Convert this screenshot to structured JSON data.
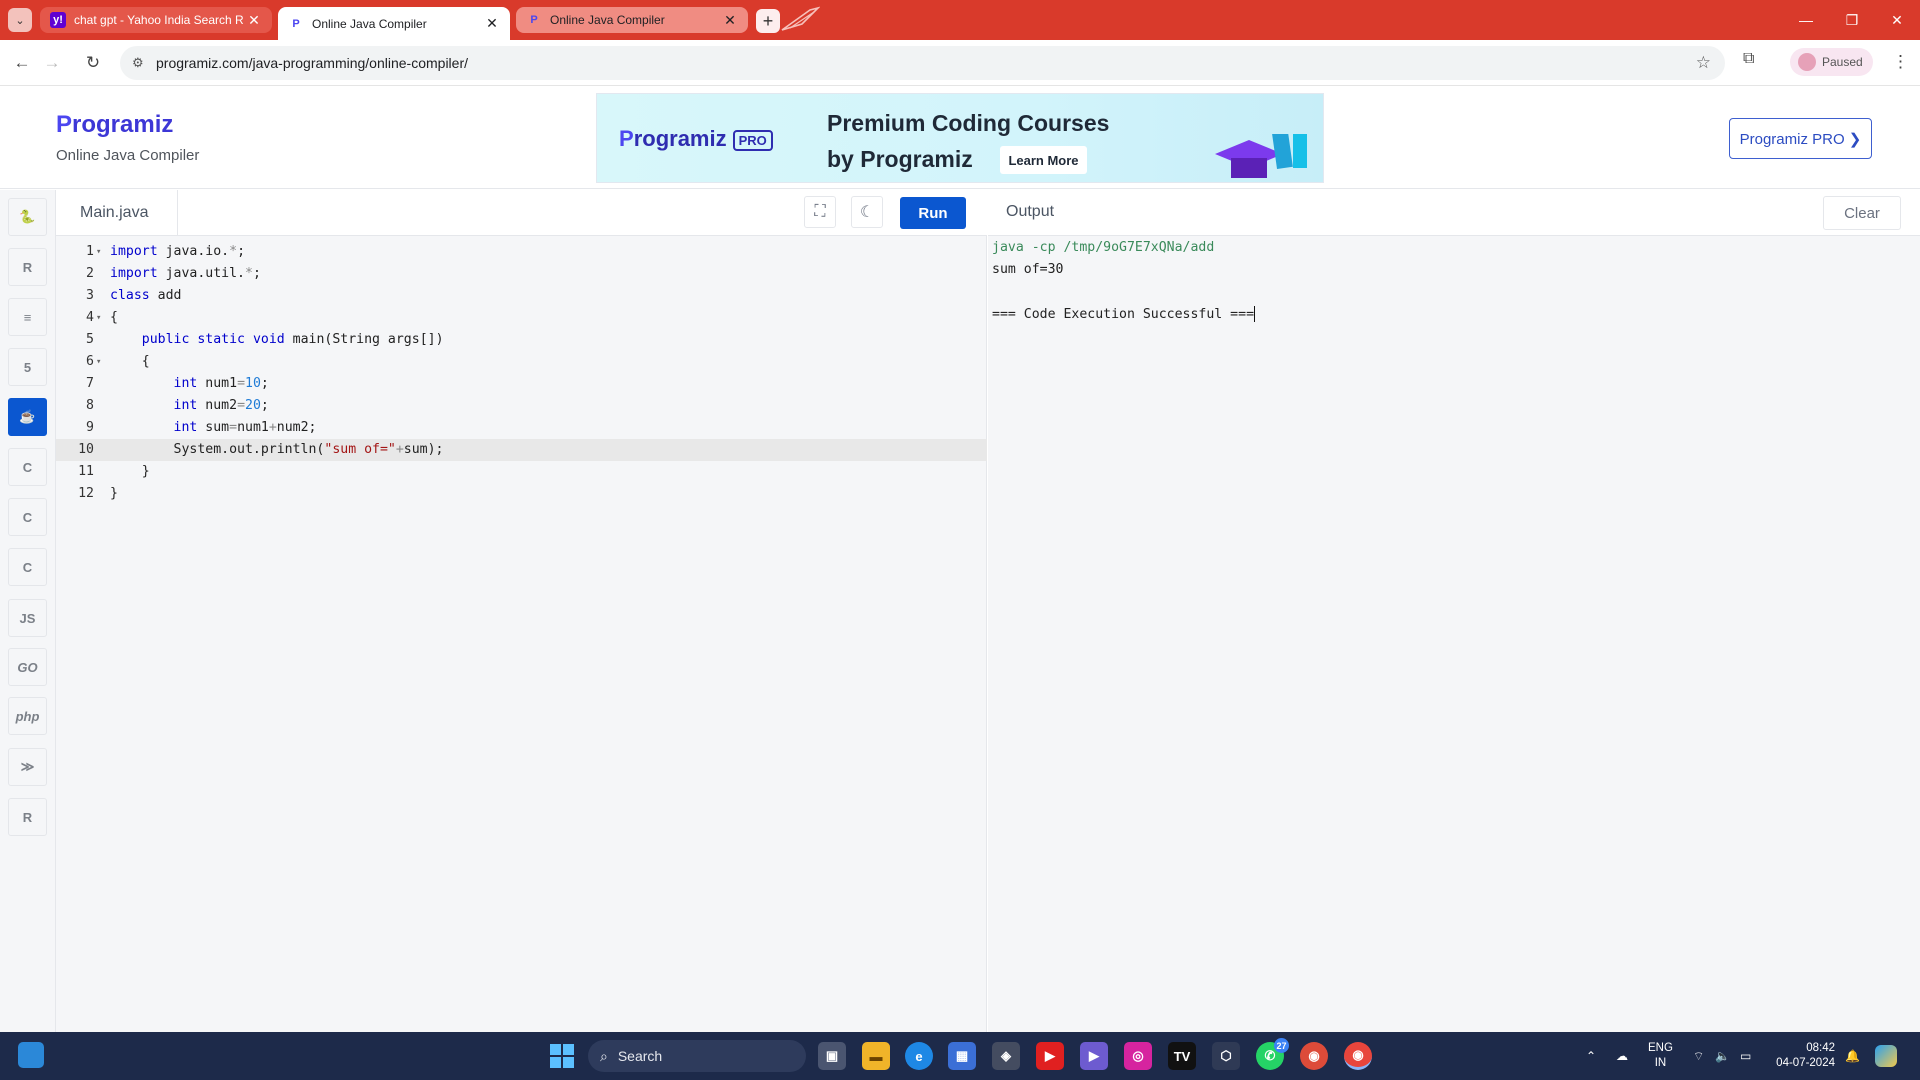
{
  "browser": {
    "tabs": [
      {
        "title": "chat gpt - Yahoo India Search R",
        "favicon": "yahoo-icon"
      },
      {
        "title": "Online Java Compiler",
        "favicon": "programiz-icon"
      },
      {
        "title": "Online Java Compiler",
        "favicon": "programiz-icon"
      }
    ],
    "url": "programiz.com/java-programming/online-compiler/",
    "profile_label": "Paused"
  },
  "site": {
    "logo_text": "rogramiz",
    "logo_letter": "P",
    "subtitle": "Online Java Compiler",
    "banner": {
      "logo_text": "rogramiz",
      "logo_letter": "P",
      "pro_tag": "PRO",
      "line1": "Premium Coding Courses",
      "line2": "by Programiz",
      "cta": "Learn More"
    },
    "pro_button": "Programiz PRO ❯"
  },
  "sidebar": {
    "languages": [
      {
        "name": "python",
        "glyph": "🐍",
        "active": false
      },
      {
        "name": "r",
        "glyph": "R",
        "active": false
      },
      {
        "name": "sql",
        "glyph": "≡",
        "active": false
      },
      {
        "name": "html",
        "glyph": "5",
        "active": false
      },
      {
        "name": "java",
        "glyph": "☕",
        "active": true
      },
      {
        "name": "c",
        "glyph": "C",
        "active": false
      },
      {
        "name": "cpp",
        "glyph": "C",
        "active": false
      },
      {
        "name": "csharp",
        "glyph": "C",
        "active": false
      },
      {
        "name": "javascript",
        "glyph": "JS",
        "active": false
      },
      {
        "name": "go",
        "glyph": "GO",
        "active": false
      },
      {
        "name": "php",
        "glyph": "php",
        "active": false
      },
      {
        "name": "swift",
        "glyph": "≫",
        "active": false
      },
      {
        "name": "rust",
        "glyph": "R",
        "active": false
      }
    ]
  },
  "editor": {
    "file_name": "Main.java",
    "run_label": "Run",
    "highlighted_line": 10,
    "lines": [
      {
        "n": "1",
        "fold": true,
        "html": "<span class='kw'>import</span> java.io.<span class='op'>*</span>;"
      },
      {
        "n": "2",
        "fold": false,
        "html": "<span class='kw'>import</span> java.util.<span class='op'>*</span>;"
      },
      {
        "n": "3",
        "fold": false,
        "html": "<span class='kw'>class</span> add"
      },
      {
        "n": "4",
        "fold": true,
        "html": "{"
      },
      {
        "n": "5",
        "fold": false,
        "html": "    <span class='kw'>public</span> <span class='kw'>static</span> <span class='kw'>void</span> main(String args[])"
      },
      {
        "n": "6",
        "fold": true,
        "html": "    {"
      },
      {
        "n": "7",
        "fold": false,
        "html": "        <span class='kw'>int</span> num1<span class='op'>=</span><span class='num'>10</span>;"
      },
      {
        "n": "8",
        "fold": false,
        "html": "        <span class='kw'>int</span> num2<span class='op'>=</span><span class='num'>20</span>;"
      },
      {
        "n": "9",
        "fold": false,
        "html": "        <span class='kw'>int</span> sum<span class='op'>=</span>num1<span class='op'>+</span>num2;"
      },
      {
        "n": "10",
        "fold": false,
        "html": "        System.out.println(<span class='str'>\"sum of=\"</span><span class='op'>+</span>sum);"
      },
      {
        "n": "11",
        "fold": false,
        "html": "    }"
      },
      {
        "n": "12",
        "fold": false,
        "html": "}"
      }
    ]
  },
  "output": {
    "title": "Output",
    "clear_label": "Clear",
    "command": "java -cp /tmp/9oG7E7xQNa/add",
    "result": "sum of=30",
    "status": "=== Code Execution Successful ==="
  },
  "taskbar": {
    "search_placeholder": "Search",
    "whatsapp_badge": "27",
    "language": "ENG",
    "region": "IN",
    "time": "08:42",
    "date": "04-07-2024"
  }
}
